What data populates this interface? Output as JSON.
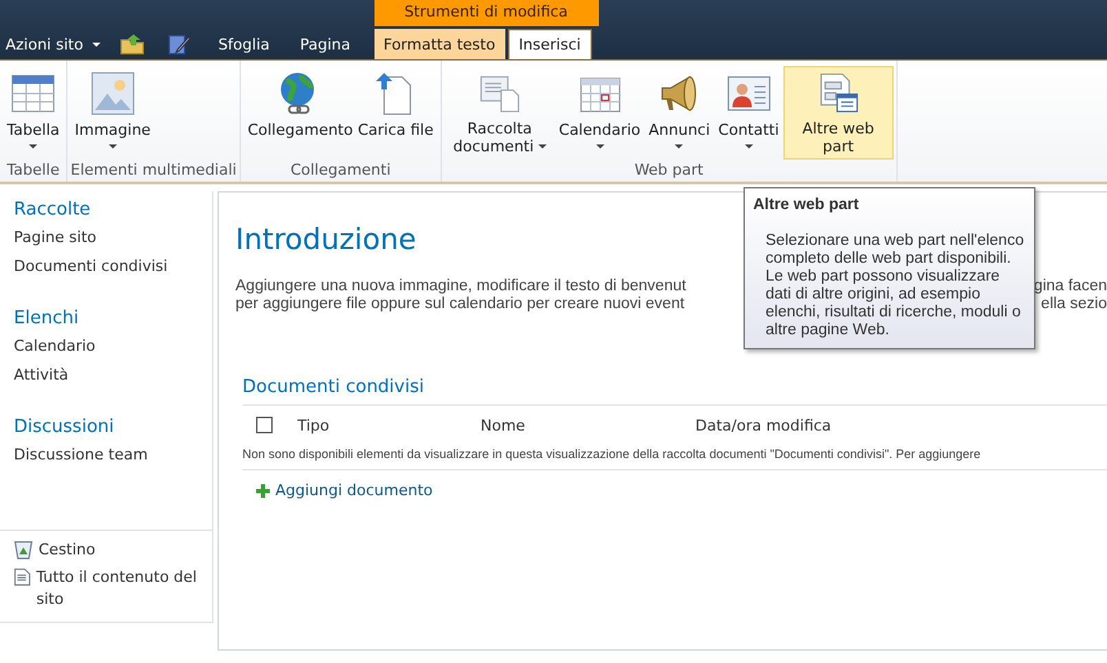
{
  "top_bar": {
    "site_actions": "Azioni sito",
    "tabs": [
      {
        "label": "Sfoglia",
        "selected": false
      },
      {
        "label": "Pagina",
        "selected": false
      }
    ],
    "context_group": {
      "title": "Strumenti di modifica",
      "tabs": [
        {
          "label": "Formatta testo",
          "selected": false
        },
        {
          "label": "Inserisci",
          "selected": true
        }
      ]
    }
  },
  "ribbon": {
    "groups": [
      {
        "label": "Tabelle",
        "buttons": [
          {
            "kind": "table",
            "label": "Tabella",
            "dropdown": true,
            "caret_beside": false,
            "selected": false
          }
        ]
      },
      {
        "label": "Elementi multimediali",
        "buttons": [
          {
            "kind": "image",
            "label": "Immagine",
            "dropdown": true,
            "caret_beside": false,
            "selected": false
          }
        ]
      },
      {
        "label": "Collegamenti",
        "buttons": [
          {
            "kind": "link",
            "label": "Collegamento",
            "dropdown": false,
            "selected": false
          },
          {
            "kind": "upload",
            "label": "Carica file",
            "dropdown": false,
            "selected": false
          }
        ]
      },
      {
        "label": "Web part",
        "buttons": [
          {
            "kind": "library",
            "label": "Raccolta documenti",
            "dropdown": true,
            "caret_beside": true,
            "selected": false
          },
          {
            "kind": "calendar",
            "label": "Calendario",
            "dropdown": true,
            "caret_beside": false,
            "selected": false
          },
          {
            "kind": "announce",
            "label": "Annunci",
            "dropdown": true,
            "caret_beside": false,
            "selected": false
          },
          {
            "kind": "contacts",
            "label": "Contatti",
            "dropdown": true,
            "caret_beside": false,
            "selected": false
          },
          {
            "kind": "webpart",
            "label": "Altre web part",
            "dropdown": false,
            "selected": true
          }
        ]
      }
    ]
  },
  "tooltip": {
    "title": "Altre web part",
    "body": "Selezionare una web part nell'elenco completo delle web part disponibili. Le web part possono visualizzare dati di altre origini, ad esempio elenchi, risultati di ricerche, moduli o altre pagine Web."
  },
  "sidebar": {
    "sections": [
      {
        "heading": "Raccolte",
        "items": [
          "Pagine sito",
          "Documenti condivisi"
        ]
      },
      {
        "heading": "Elenchi",
        "items": [
          "Calendario",
          "Attività"
        ]
      },
      {
        "heading": "Discussioni",
        "items": [
          "Discussione team"
        ]
      }
    ],
    "footer_links": [
      {
        "kind": "recycle",
        "label": "Cestino"
      },
      {
        "kind": "contents",
        "label": "Tutto il contenuto del sito"
      }
    ]
  },
  "content": {
    "title": "Introduzione",
    "paragraph_lines": [
      {
        "left": "Aggiungere una nuova immagine, modificare il testo di benvenut",
        "right": "gina facen"
      },
      {
        "left": "per aggiungere file oppure sul calendario per creare nuovi event",
        "right": "ella sezio"
      }
    ],
    "list": {
      "heading": "Documenti condivisi",
      "select_all": {
        "checked": false
      },
      "columns": [
        "Tipo",
        "Nome",
        "Data/ora modifica"
      ],
      "empty_message": "Non sono disponibili elementi da visualizzare in questa visualizzazione della raccolta documenti \"Documenti condivisi\". Per aggiungere",
      "add_link": "Aggiungi documento"
    }
  }
}
